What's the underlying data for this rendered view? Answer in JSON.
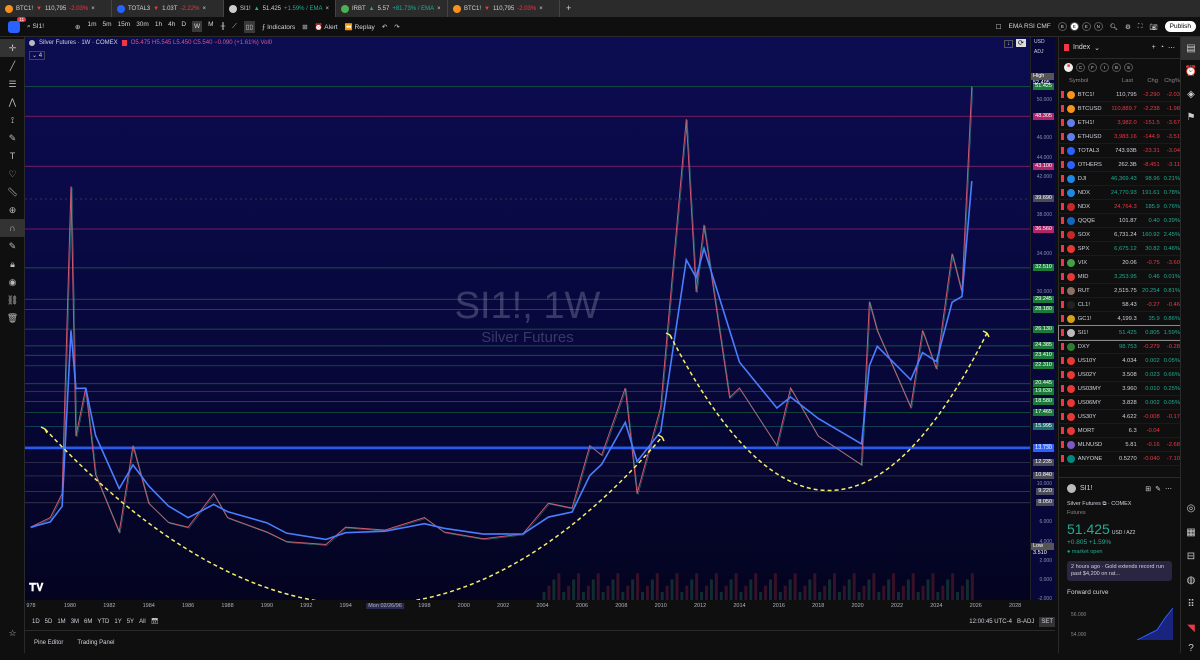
{
  "tabs": [
    {
      "symbol": "BTC1!",
      "arrow": "▼",
      "price": "110,795",
      "change": "-2.03%",
      "dir": "down",
      "color": "#f7931a"
    },
    {
      "symbol": "TOTAL3",
      "arrow": "▼",
      "price": "1.03T",
      "change": "-2.22%",
      "dir": "down",
      "color": "#2962ff"
    },
    {
      "symbol": "SI1!",
      "arrow": "▲",
      "price": "51.425",
      "change": "+1.59% / EMA",
      "dir": "up",
      "color": "#cccccc"
    },
    {
      "symbol": "IRBT",
      "arrow": "▲",
      "price": "5.57",
      "change": "+81.73% / EMA",
      "dir": "up",
      "color": "#4caf50"
    },
    {
      "symbol": "BTC1!",
      "arrow": "▼",
      "price": "110,795",
      "change": "-2.03%",
      "dir": "down",
      "color": "#f7931a"
    }
  ],
  "toolbar": {
    "notif_count": "11",
    "symbol": "SI1!",
    "intervals": [
      "1m",
      "5m",
      "15m",
      "30m",
      "1h",
      "4h",
      "D",
      "W",
      "M"
    ],
    "selected_interval": "W",
    "indicators": "Indicators",
    "alert": "Alert",
    "replay": "Replay",
    "template": "EMA RSI CMF",
    "publish": "Publish",
    "sessions": [
      "B",
      "E",
      "E",
      "N"
    ]
  },
  "legend": {
    "title": "Silver Futures · 1W · COMEX",
    "ohlc": "O5.475 H5.545 L5.450 C5.540 −0.090 (+1.61%) Vol0",
    "indicator_count": "4"
  },
  "watermark": {
    "main": "SI1!, 1W",
    "sub": "Silver Futures"
  },
  "price_axis": {
    "currency": "USD",
    "adj": "ADJ",
    "high_label": "High",
    "high": "52.495",
    "low_label": "Low",
    "low": "3.510",
    "ticks": [
      "50.000",
      "46.000",
      "44.000",
      "42.000",
      "38.000",
      "34.000",
      "30.000",
      "10.000",
      "6.000",
      "4.000",
      "2.000",
      "0.000",
      "-2.000"
    ],
    "levels": [
      {
        "v": 51.425,
        "t": "51.425",
        "c": "#1b7a3a"
      },
      {
        "v": 48.305,
        "t": "48.305",
        "c": "#b0246a"
      },
      {
        "v": 43.1,
        "t": "43.100",
        "c": "#b0246a"
      },
      {
        "v": 39.69,
        "t": "39.690",
        "c": "#4a4a5a"
      },
      {
        "v": 36.56,
        "t": "36.560",
        "c": "#b0246a"
      },
      {
        "v": 32.51,
        "t": "32.510",
        "c": "#1b7a3a"
      },
      {
        "v": 29.245,
        "t": "29.245",
        "c": "#1b7a3a"
      },
      {
        "v": 28.18,
        "t": "28.180",
        "c": "#1b7a3a"
      },
      {
        "v": 26.13,
        "t": "26.130",
        "c": "#1b7a3a"
      },
      {
        "v": 24.385,
        "t": "24.385",
        "c": "#1b7a3a"
      },
      {
        "v": 23.41,
        "t": "23.410",
        "c": "#1b7a3a"
      },
      {
        "v": 22.31,
        "t": "22.310",
        "c": "#1b7a3a"
      },
      {
        "v": 20.445,
        "t": "20.445",
        "c": "#1b7a3a"
      },
      {
        "v": 19.63,
        "t": "19.630",
        "c": "#1b7a3a"
      },
      {
        "v": 18.58,
        "t": "18.580",
        "c": "#1b7a3a"
      },
      {
        "v": 17.465,
        "t": "17.465",
        "c": "#1b7a3a"
      },
      {
        "v": 15.995,
        "t": "15.995",
        "c": "#1a6e6e"
      },
      {
        "v": 13.805,
        "t": "13.805",
        "c": "#2962ff"
      },
      {
        "v": 13.73,
        "t": "13.730",
        "c": "#2962ff"
      },
      {
        "v": 12.235,
        "t": "12.235",
        "c": "#4a4a5a"
      },
      {
        "v": 10.84,
        "t": "10.840",
        "c": "#4a4a5a"
      },
      {
        "v": 9.22,
        "t": "9.220",
        "c": "#4a4a5a"
      },
      {
        "v": 8.05,
        "t": "8.050",
        "c": "#4a4a5a"
      }
    ]
  },
  "chart_data": {
    "type": "line",
    "title": "SI1!, 1W",
    "ylim": [
      -2,
      56
    ],
    "xlim": [
      1978,
      2028.5
    ],
    "x": [
      1978,
      1979,
      1979.6,
      1980.05,
      1980.3,
      1980.8,
      1981.3,
      1982.5,
      1983.2,
      1984,
      1985,
      1986,
      1987.3,
      1988,
      1990,
      1991,
      1993,
      1994,
      1996,
      1998,
      1999,
      2001,
      2003,
      2004.3,
      2005.5,
      2006.4,
      2007,
      2008.2,
      2008.8,
      2010,
      2011.3,
      2011.8,
      2012.2,
      2013.5,
      2014,
      2015.9,
      2016.6,
      2018,
      2020.2,
      2020.6,
      2021,
      2022.7,
      2023.3,
      2024,
      2024.8,
      2025.3,
      2025.8
    ],
    "y": [
      5.5,
      6.5,
      9,
      41,
      15,
      20,
      11,
      5,
      14,
      8,
      6,
      5.5,
      9,
      6.5,
      5,
      4,
      3.7,
      5.5,
      5.2,
      6.5,
      5,
      4.3,
      4.8,
      8,
      7.5,
      14,
      13,
      20,
      9,
      18,
      48,
      30,
      37,
      19,
      20,
      14,
      20,
      15,
      12,
      29,
      26,
      18,
      26,
      22,
      34,
      30,
      51.4
    ],
    "x_ticks": [
      "978",
      "1980",
      "1982",
      "1984",
      "1986",
      "1988",
      "1990",
      "1992",
      "1994",
      "Mon 02/26/96",
      "1998",
      "2000",
      "2002",
      "2004",
      "2006",
      "2008",
      "2010",
      "2012",
      "2014",
      "2016",
      "2018",
      "2020",
      "2022",
      "2024",
      "2026",
      "2028"
    ]
  },
  "ranges": [
    "1D",
    "5D",
    "1M",
    "3M",
    "6M",
    "YTD",
    "1Y",
    "5Y",
    "All"
  ],
  "status": {
    "time": "12:00:45 UTC-4",
    "badj": "B-ADJ",
    "set": "SET"
  },
  "bottom": {
    "pine": "Pine Editor",
    "trading": "Trading Panel"
  },
  "watchlist": {
    "title": "Index",
    "headers": {
      "symbol": "Symbol",
      "last": "Last",
      "chg": "Chg",
      "chgp": "Chg%"
    },
    "filters": [
      "C",
      "F",
      "I",
      "B",
      "S"
    ],
    "rows": [
      {
        "s": "BTC1!",
        "l": "110,795",
        "c": "-2.290",
        "p": "-2.03",
        "lc": "neu",
        "d": "down",
        "ic": "#f7931a"
      },
      {
        "s": "BTCUSD",
        "l": "110,889.7",
        "c": "-2.238",
        "p": "-1.98",
        "lc": "down",
        "d": "down",
        "ic": "#f7931a"
      },
      {
        "s": "ETH1!",
        "l": "3,982.0",
        "c": "-151.5",
        "p": "-3.67",
        "lc": "down",
        "d": "down",
        "ic": "#627eea"
      },
      {
        "s": "ETHUSD",
        "l": "3,983.16",
        "c": "-144.9",
        "p": "-3.51",
        "lc": "down",
        "d": "down",
        "ic": "#627eea"
      },
      {
        "s": "TOTAL3",
        "l": "743.93B",
        "c": "-23.31",
        "p": "-3.04",
        "lc": "neu",
        "d": "down",
        "ic": "#2962ff"
      },
      {
        "s": "OTHERS",
        "l": "262.3B",
        "c": "-8.451",
        "p": "-3.11",
        "lc": "neu",
        "d": "down",
        "ic": "#2962ff"
      },
      {
        "s": "DJI",
        "l": "46,369.43",
        "c": "98.96",
        "p": "0.21%",
        "lc": "up",
        "d": "up",
        "ic": "#1e88e5"
      },
      {
        "s": "NDX",
        "l": "24,770.93",
        "c": "191.61",
        "p": "0.78%",
        "lc": "up",
        "d": "up",
        "ic": "#1e88e5"
      },
      {
        "s": "NDX",
        "l": "24,764.3",
        "c": "185.9",
        "p": "0.76%",
        "lc": "down",
        "d": "up",
        "ic": "#c62828"
      },
      {
        "s": "QQQE",
        "l": "101.87",
        "c": "0.40",
        "p": "0.39%",
        "lc": "neu",
        "d": "up",
        "ic": "#1565c0"
      },
      {
        "s": "SOX",
        "l": "6,731.24",
        "c": "160.92",
        "p": "2.45%",
        "lc": "neu",
        "d": "up",
        "ic": "#c62828"
      },
      {
        "s": "SPX",
        "l": "6,675.12",
        "c": "30.82",
        "p": "0.46%",
        "lc": "up",
        "d": "up",
        "ic": "#e53935"
      },
      {
        "s": "VIX",
        "l": "20.06",
        "c": "-0.75",
        "p": "-3.60",
        "lc": "neu",
        "d": "down",
        "ic": "#43a047"
      },
      {
        "s": "MID",
        "l": "3,253.95",
        "c": "0.46",
        "p": "0.01%",
        "lc": "up",
        "d": "up",
        "ic": "#e53935"
      },
      {
        "s": "RUT",
        "l": "2,515.75",
        "c": "20.254",
        "p": "0.81%",
        "lc": "neu",
        "d": "up",
        "ic": "#8d6e63"
      },
      {
        "s": "CL1!",
        "l": "58.43",
        "c": "-0.27",
        "p": "-0.46",
        "lc": "neu",
        "d": "down",
        "ic": "#222222"
      },
      {
        "s": "GC1!",
        "l": "4,199.3",
        "c": "35.9",
        "p": "0.86%",
        "lc": "neu",
        "d": "up",
        "ic": "#d4a017"
      },
      {
        "s": "SI1!",
        "l": "51.425",
        "c": "0.805",
        "p": "1.59%",
        "lc": "up",
        "d": "up",
        "ic": "#bbbbbb",
        "sel": true
      },
      {
        "s": "DXY",
        "l": "98.753",
        "c": "-0.279",
        "p": "-0.28",
        "lc": "up",
        "d": "down",
        "ic": "#2e7d32"
      },
      {
        "s": "US10Y",
        "l": "4.034",
        "c": "0.002",
        "p": "0.05%",
        "lc": "neu",
        "d": "up",
        "ic": "#e53935"
      },
      {
        "s": "US02Y",
        "l": "3.508",
        "c": "0.023",
        "p": "0.66%",
        "lc": "neu",
        "d": "up",
        "ic": "#e53935"
      },
      {
        "s": "US03MY",
        "l": "3.960",
        "c": "0.010",
        "p": "0.25%",
        "lc": "neu",
        "d": "up",
        "ic": "#e53935"
      },
      {
        "s": "US06MY",
        "l": "3.828",
        "c": "0.002",
        "p": "0.05%",
        "lc": "neu",
        "d": "up",
        "ic": "#e53935"
      },
      {
        "s": "US30Y",
        "l": "4.622",
        "c": "-0.008",
        "p": "-0.17",
        "lc": "neu",
        "d": "down",
        "ic": "#e53935"
      },
      {
        "s": "MORT",
        "l": "6.3",
        "c": "-0.04",
        "p": "",
        "lc": "neu",
        "d": "down",
        "ic": "#e53935"
      },
      {
        "s": "MLNUSD",
        "l": "5.81",
        "c": "-0.16",
        "p": "-2.68",
        "lc": "neu",
        "d": "down",
        "ic": "#7e57c2"
      },
      {
        "s": "ANYONE",
        "l": "0.5270",
        "c": "-0.040",
        "p": "-7.10",
        "lc": "neu",
        "d": "down",
        "ic": "#00897b"
      }
    ]
  },
  "detail": {
    "symbol": "SI1!",
    "name": "Silver Futures",
    "exchange": "· COMEX",
    "type": "Futures",
    "price": "51.425",
    "unit": "USD / AZ2",
    "change": "+0.805",
    "change_pct": "+1.59%",
    "status": "market open",
    "news_time": "2 hours ago",
    "news": "· Gold extends record run past $4,200 on rat...",
    "forward_curve": "Forward curve",
    "fc_ticks": [
      "56.000",
      "54.000"
    ]
  }
}
